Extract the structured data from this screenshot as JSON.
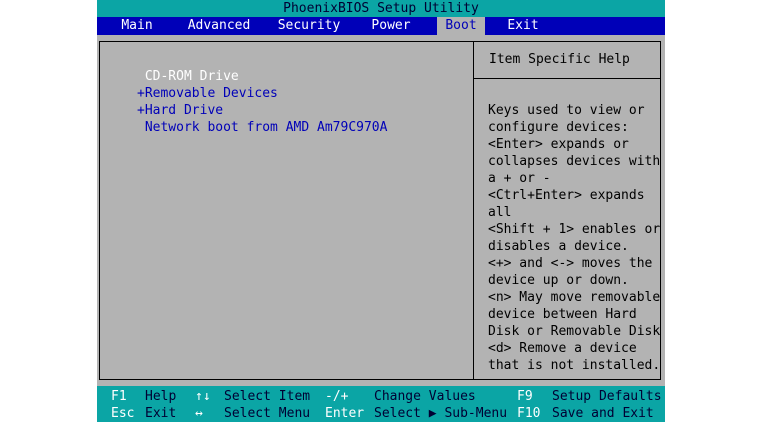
{
  "title": "PhoenixBIOS Setup Utility",
  "menu": [
    {
      "label": "Main",
      "active": false
    },
    {
      "label": "Advanced",
      "active": false
    },
    {
      "label": "Security",
      "active": false
    },
    {
      "label": "Power",
      "active": false
    },
    {
      "label": "Boot",
      "active": true
    },
    {
      "label": "Exit",
      "active": false
    }
  ],
  "boot_items": [
    {
      "label": " CD-ROM Drive",
      "selected": true
    },
    {
      "label": "+Removable Devices",
      "selected": false
    },
    {
      "label": "+Hard Drive",
      "selected": false
    },
    {
      "label": " Network boot from AMD Am79C970A",
      "selected": false
    }
  ],
  "help": {
    "title": "Item Specific Help",
    "lines": [
      "Keys used to view or",
      "configure devices:",
      "<Enter> expands or",
      "collapses devices with",
      "a + or -",
      "<Ctrl+Enter> expands",
      "all",
      "<Shift + 1> enables or",
      "disables a device.",
      "<+> and <-> moves the",
      "device up or down.",
      "<n> May move removable",
      "device between Hard",
      "Disk or Removable Disk",
      "<d> Remove a device",
      "that is not installed."
    ]
  },
  "footer": {
    "row1": [
      {
        "key": "F1",
        "label": "Help"
      },
      {
        "key": "↑↓",
        "label": "Select Item"
      },
      {
        "key": "-/+",
        "label": "Change Values"
      },
      {
        "key": "F9",
        "label": "Setup Defaults"
      }
    ],
    "row2": [
      {
        "key": "Esc",
        "label": "Exit"
      },
      {
        "key": "↔",
        "label": "Select Menu"
      },
      {
        "key": "Enter",
        "label": "Select ▶ Sub-Menu"
      },
      {
        "key": "F10",
        "label": "Save and Exit"
      }
    ]
  },
  "colors": {
    "teal": "#0ba5a5",
    "blue": "#0000b8",
    "gray": "#b3b3b3",
    "white": "#ffffff"
  }
}
